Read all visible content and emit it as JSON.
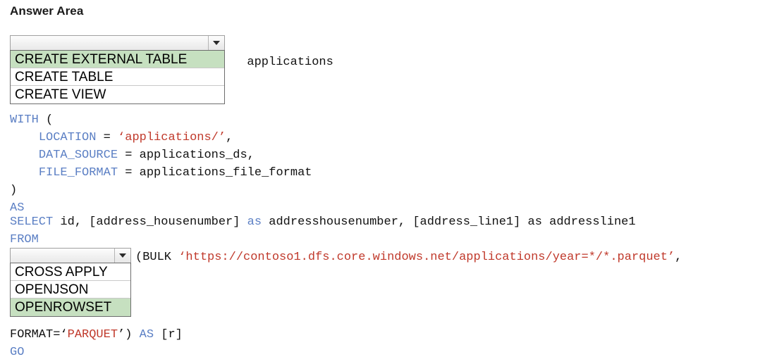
{
  "page": {
    "title": "Answer Area"
  },
  "dropdowns": [
    {
      "name": "statement-dropdown",
      "value": "",
      "placeholder": "",
      "caret_icon": "chevron-down-icon",
      "options": [
        {
          "label": "CREATE EXTERNAL TABLE",
          "selected": true
        },
        {
          "label": "CREATE TABLE",
          "selected": false
        },
        {
          "label": "CREATE VIEW",
          "selected": false
        }
      ]
    },
    {
      "name": "source-dropdown",
      "value": "",
      "placeholder": "",
      "caret_icon": "chevron-down-icon",
      "options": [
        {
          "label": "CROSS APPLY",
          "selected": false
        },
        {
          "label": "OPENJSON",
          "selected": false
        },
        {
          "label": "OPENROWSET",
          "selected": true
        }
      ]
    }
  ],
  "code": {
    "object_name": "applications",
    "with_block": {
      "line_with": "WITH",
      "paren_open": " (",
      "location_key": "LOCATION",
      "location_eq": " = ",
      "location_value": "‘applications/’",
      "location_comma": ",",
      "data_source_key": "DATA_SOURCE",
      "data_source_eq": " = ",
      "data_source_value": "applications_ds,",
      "file_format_key": "FILE_FORMAT",
      "file_format_eq": " = ",
      "file_format_value": "applications_file_format",
      "paren_close": ")",
      "as_keyword": "AS"
    },
    "select_block": {
      "select_keyword": "SELECT",
      "select_cols_a": " id, [address_housenumber] ",
      "as_keyword_1": "as",
      "select_cols_b": " addresshousenumber, [address_line1] as addressline1",
      "from_keyword": "FROM"
    },
    "bulk_line": {
      "prefix": "(BULK ",
      "url": "‘https://contoso1.dfs.core.windows.net/applications/year=*/*.parquet’",
      "suffix": ","
    },
    "tail_block": {
      "format_key": "FORMAT=‘",
      "format_value": "PARQUET",
      "format_close": "’) ",
      "as_keyword": "AS",
      "alias": " [r]",
      "go_keyword": "GO"
    }
  },
  "colors": {
    "keyword_blue": "#5b7fc4",
    "string_red": "#c0392b",
    "selected_green": "#c6e0c0",
    "text_black": "#111111"
  }
}
